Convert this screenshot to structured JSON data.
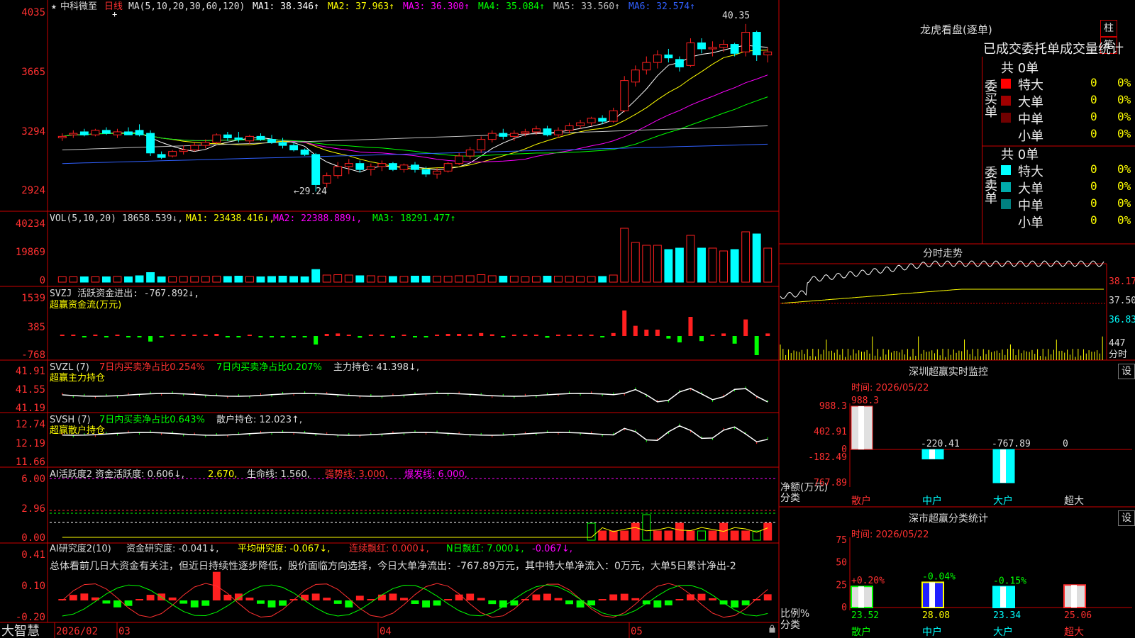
{
  "stock": {
    "name_prefix": "★",
    "name": "中科微至",
    "period": "日线"
  },
  "colors": {
    "up": "#ff2020",
    "down": "#00ffff",
    "grid": "#cc0000",
    "bg": "#000000",
    "axis_text": "#ff3030"
  },
  "main_chart": {
    "ma_label": "MA(5,10,20,30,60,120)",
    "mas": [
      {
        "label": "MA1: 38.346↑",
        "color": "#ffffff"
      },
      {
        "label": "MA2: 37.963↑",
        "color": "#ffff00"
      },
      {
        "label": "MA3: 36.300↑",
        "color": "#ff00ff"
      },
      {
        "label": "MA4: 35.084↑",
        "color": "#00ff00"
      },
      {
        "label": "MA5: 33.560↑",
        "color": "#c0c0c0"
      },
      {
        "label": "MA6: 32.574↑",
        "color": "#3060ff"
      }
    ],
    "yticks": [
      "4035",
      "3665",
      "3294",
      "2924"
    ],
    "high_label": "40.35",
    "low_label": "←29.24"
  },
  "vol_panel": {
    "label": "VOL(5,10,20)",
    "value": "18658.539↓,",
    "mas": [
      {
        "label": "MA1: 23438.416↓,",
        "color": "#ffff00"
      },
      {
        "label": "MA2: 22388.889↓,",
        "color": "#ff00ff"
      },
      {
        "label": "MA3: 18291.477↑",
        "color": "#00ff00"
      }
    ],
    "yticks": [
      "40234",
      "19869",
      "0"
    ]
  },
  "svzj_panel": {
    "line1": "SVZJ  活跃资金进出: -767.892↓,",
    "line2": "超赢资金流(万元)",
    "yticks": [
      "1539",
      "385",
      "-768"
    ]
  },
  "svzl_panel": {
    "name": "SVZL (7)",
    "p1": "7日内买卖净占比0.254%",
    "p2": "7日内买卖净占比0.207%",
    "p3": "主力持仓: 41.398↓,",
    "line2": "超赢主力持仓",
    "yticks": [
      "41.91",
      "41.55",
      "41.19"
    ]
  },
  "svsh_panel": {
    "name": "SVSH (7)",
    "p1": "7日内买卖净占比0.643%",
    "p2": "散户持仓: 12.023↑,",
    "line2": "超赢散户持仓",
    "yticks": [
      "12.74",
      "12.19",
      "11.66"
    ]
  },
  "ai_active_panel": {
    "p1": "AI活跃度2 资金活跃度: 0.606↓,",
    "p2": "2.670,",
    "p3": "生命线: 1.560,",
    "p4": "强势线: 3.000,",
    "p5": "爆发线: 6.000,",
    "yticks": [
      "6.00",
      "2.96",
      "0.00"
    ]
  },
  "ai_research_panel": {
    "p1": "AI研究度2(10)",
    "p2": "资金研究度: -0.041↓,",
    "p3": "平均研究度: -0.067↓,",
    "p4": "连续飘红: 0.000↓,",
    "p5": "N日飘红: 7.000↓,",
    "p6": "-0.067↓,",
    "summary": "总体看前几日大资金有关注，但近日持续性逐步降低，股价面临方向选择，今日大单净流出：-767.89万元，其中特大单净流入：0万元，大单5日累计净出-2",
    "yticks": [
      "0.41",
      "0.10",
      "-0.20"
    ]
  },
  "status_bar": {
    "brand": "大智慧",
    "dates": [
      "2026/02",
      "03",
      "04",
      "05"
    ]
  },
  "sidebar": {
    "tabs": [
      "柱",
      "笔"
    ],
    "dragon": {
      "title": "龙虎看盘(逐单)",
      "header": "已成交委托单成交量统计",
      "buy_side": "委买单",
      "sell_side": "委卖单",
      "buy_total": "共 0单",
      "sell_total": "共 0单",
      "buy_rows": [
        {
          "label": "特大",
          "value": "0",
          "pct": "0%",
          "color": "#ff0000"
        },
        {
          "label": "大单",
          "value": "0",
          "pct": "0%",
          "color": "#a00000"
        },
        {
          "label": "中单",
          "value": "0",
          "pct": "0%",
          "color": "#700000"
        },
        {
          "label": "小单",
          "value": "0",
          "pct": "0%",
          "color": "#000000"
        }
      ],
      "sell_rows": [
        {
          "label": "特大",
          "value": "0",
          "pct": "0%",
          "color": "#00ffff"
        },
        {
          "label": "大单",
          "value": "0",
          "pct": "0%",
          "color": "#00aaaa"
        },
        {
          "label": "中单",
          "value": "0",
          "pct": "0%",
          "color": "#008080"
        },
        {
          "label": "小单",
          "value": "0",
          "pct": "0%",
          "color": "#000000"
        }
      ]
    },
    "intraday": {
      "title": "分时走势",
      "yticks": [
        "38.17",
        "37.50",
        "36.83"
      ],
      "vol_tick": "447",
      "vol_unit": "分时"
    },
    "sz_monitor": {
      "title": "深圳超赢实时监控",
      "gear": "设",
      "date": "时间: 2026/05/22",
      "yticks": [
        "988.3",
        "402.91",
        "0",
        "-182.49",
        "-767.89"
      ],
      "ylabel": "净额(万元)",
      "xlabel": "分类",
      "bar_labels": [
        "988.3",
        "-220.41",
        "-767.89",
        "0"
      ],
      "categories": [
        "散户",
        "中户",
        "大户",
        "超大"
      ],
      "values": [
        988.3,
        -220.41,
        -767.89,
        0
      ]
    },
    "sz_stats": {
      "title": "深市超赢分类统计",
      "gear": "设",
      "date": "时间: 2026/05/22",
      "yticks": [
        "75",
        "50",
        "25",
        "0"
      ],
      "ylabel": "比例%",
      "xlabel": "分类",
      "top_labels": [
        "+0.20%",
        "-0.04%",
        "-0.15%"
      ],
      "values": [
        23.52,
        28.08,
        23.34,
        25.06
      ],
      "value_labels": [
        "23.52",
        "28.08",
        "23.34",
        "25.06"
      ],
      "categories": [
        "散户",
        "中户",
        "大户",
        "超大"
      ]
    }
  },
  "chart_data": [
    {
      "type": "candlestick",
      "title": "中科微至 日线",
      "x": [
        "2026/02",
        "03",
        "04",
        "05"
      ],
      "ylim": [
        29.24,
        40.35
      ],
      "ohlc": [
        [
          32.8,
          33.1,
          32.6,
          32.9
        ],
        [
          33.0,
          33.3,
          32.8,
          33.1
        ],
        [
          33.2,
          33.4,
          32.9,
          33.0
        ],
        [
          33.0,
          33.4,
          32.9,
          33.3
        ],
        [
          33.3,
          33.5,
          33.0,
          33.1
        ],
        [
          33.0,
          33.4,
          32.8,
          33.2
        ],
        [
          33.2,
          33.5,
          33.0,
          33.0
        ],
        [
          33.3,
          33.7,
          32.9,
          33.0
        ],
        [
          33.1,
          33.3,
          31.6,
          31.8
        ],
        [
          31.7,
          31.9,
          31.4,
          31.5
        ],
        [
          31.6,
          32.0,
          31.5,
          31.9
        ],
        [
          31.9,
          32.3,
          31.7,
          32.0
        ],
        [
          32.0,
          32.5,
          31.9,
          32.3
        ],
        [
          32.3,
          32.7,
          32.1,
          32.5
        ],
        [
          32.5,
          33.1,
          32.4,
          33.0
        ],
        [
          33.0,
          33.2,
          32.6,
          32.8
        ],
        [
          32.8,
          33.2,
          32.5,
          32.7
        ],
        [
          32.6,
          33.0,
          32.4,
          32.9
        ],
        [
          32.9,
          33.1,
          32.6,
          32.7
        ],
        [
          32.7,
          33.0,
          32.4,
          32.5
        ],
        [
          32.5,
          32.8,
          32.1,
          32.3
        ],
        [
          32.3,
          32.5,
          31.9,
          32.0
        ],
        [
          32.0,
          32.1,
          31.6,
          31.7
        ],
        [
          31.7,
          31.8,
          29.24,
          29.7
        ],
        [
          29.8,
          30.5,
          29.5,
          30.3
        ],
        [
          30.3,
          31.2,
          30.1,
          30.9
        ],
        [
          30.9,
          31.4,
          30.4,
          31.1
        ],
        [
          31.1,
          31.3,
          30.5,
          30.7
        ],
        [
          30.7,
          31.1,
          30.3,
          30.9
        ],
        [
          30.9,
          31.3,
          30.6,
          31.1
        ],
        [
          31.1,
          31.2,
          30.6,
          30.7
        ],
        [
          30.7,
          31.1,
          30.5,
          31.0
        ],
        [
          31.0,
          31.2,
          30.5,
          30.7
        ],
        [
          30.7,
          30.9,
          30.2,
          30.4
        ],
        [
          30.4,
          30.8,
          30.1,
          30.6
        ],
        [
          30.6,
          31.2,
          30.5,
          31.1
        ],
        [
          31.1,
          31.8,
          31.0,
          31.6
        ],
        [
          31.6,
          32.2,
          31.4,
          32.0
        ],
        [
          32.0,
          32.9,
          31.8,
          32.7
        ],
        [
          32.7,
          33.3,
          32.5,
          33.1
        ],
        [
          33.1,
          33.4,
          32.7,
          32.9
        ],
        [
          32.9,
          33.3,
          32.6,
          33.1
        ],
        [
          33.1,
          33.4,
          32.9,
          33.2
        ],
        [
          33.2,
          33.6,
          33.0,
          33.4
        ],
        [
          33.4,
          33.6,
          32.9,
          33.0
        ],
        [
          33.0,
          33.5,
          32.8,
          33.3
        ],
        [
          33.3,
          33.8,
          33.1,
          33.6
        ],
        [
          33.6,
          34.0,
          33.4,
          33.8
        ],
        [
          33.8,
          34.2,
          33.6,
          34.1
        ],
        [
          34.1,
          34.3,
          33.7,
          33.9
        ],
        [
          33.9,
          34.8,
          33.8,
          34.6
        ],
        [
          34.6,
          36.9,
          34.5,
          36.6
        ],
        [
          36.5,
          37.6,
          36.2,
          37.3
        ],
        [
          37.3,
          38.2,
          37.0,
          37.8
        ],
        [
          37.8,
          38.6,
          37.4,
          38.3
        ],
        [
          38.3,
          38.7,
          37.8,
          38.1
        ],
        [
          38.0,
          38.2,
          37.2,
          37.5
        ],
        [
          37.6,
          39.4,
          37.5,
          39.1
        ],
        [
          39.1,
          39.4,
          38.4,
          38.7
        ],
        [
          38.7,
          39.2,
          38.2,
          38.8
        ],
        [
          38.8,
          39.3,
          38.5,
          39.0
        ],
        [
          39.0,
          39.1,
          38.2,
          38.4
        ],
        [
          38.5,
          40.35,
          38.2,
          39.8
        ],
        [
          39.8,
          39.9,
          37.9,
          38.3
        ],
        [
          38.3,
          38.8,
          37.8,
          38.5
        ]
      ]
    },
    {
      "type": "bar",
      "title": "深圳超赢实时监控",
      "categories": [
        "散户",
        "中户",
        "大户",
        "超大"
      ],
      "values": [
        988.3,
        -220.41,
        -767.89,
        0
      ],
      "ylim": [
        -767.89,
        988.3
      ],
      "ylabel": "净额(万元)"
    },
    {
      "type": "bar",
      "title": "深市超赢分类统计",
      "categories": [
        "散户",
        "中户",
        "大户",
        "超大"
      ],
      "values": [
        23.52,
        28.08,
        23.34,
        25.06
      ],
      "ylim": [
        0,
        75
      ],
      "ylabel": "比例%"
    }
  ]
}
